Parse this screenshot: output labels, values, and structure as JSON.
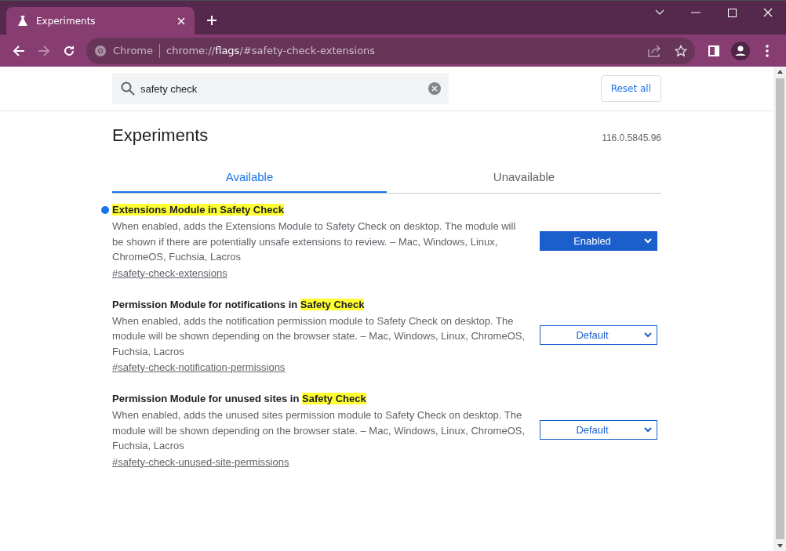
{
  "window": {
    "tabs": [
      {
        "title": "Experiments",
        "selected": true
      }
    ]
  },
  "toolbar": {
    "site_label": "Chrome",
    "url": {
      "scheme": "chrome://",
      "host": "flags",
      "path": "/#safety-check-extensions"
    }
  },
  "search": {
    "value": "safety check"
  },
  "reset_button": "Reset all",
  "page": {
    "title": "Experiments",
    "version": "116.0.5845.96"
  },
  "tabs": [
    {
      "label": "Available",
      "selected": true
    },
    {
      "label": "Unavailable",
      "selected": false
    }
  ],
  "flags": [
    {
      "title": [
        {
          "text": "Extensions Module in Safety Check",
          "highlighted": true
        }
      ],
      "modified": true,
      "description": "When enabled, adds the Extensions Module to Safety Check on desktop. The module will be shown if there are potentially unsafe extensions to review. – Mac, Windows, Linux, ChromeOS, Fuchsia, Lacros",
      "link": "#safety-check-extensions",
      "value": "Enabled"
    },
    {
      "title": [
        {
          "text": "Permission Module for notifications in ",
          "highlighted": false
        },
        {
          "text": "Safety Check",
          "highlighted": true
        }
      ],
      "modified": false,
      "description": "When enabled, adds the notification permission module to Safety Check on desktop. The module will be shown depending on the browser state. – Mac, Windows, Linux, ChromeOS, Fuchsia, Lacros",
      "link": "#safety-check-notification-permissions",
      "value": "Default"
    },
    {
      "title": [
        {
          "text": "Permission Module for unused sites in ",
          "highlighted": false
        },
        {
          "text": "Safety Check",
          "highlighted": true
        }
      ],
      "modified": false,
      "description": "When enabled, adds the unused sites permission module to Safety Check on desktop. The module will be shown depending on the browser state. – Mac, Windows, Linux, ChromeOS, Fuchsia, Lacros",
      "link": "#safety-check-unused-site-permissions",
      "value": "Default"
    }
  ]
}
